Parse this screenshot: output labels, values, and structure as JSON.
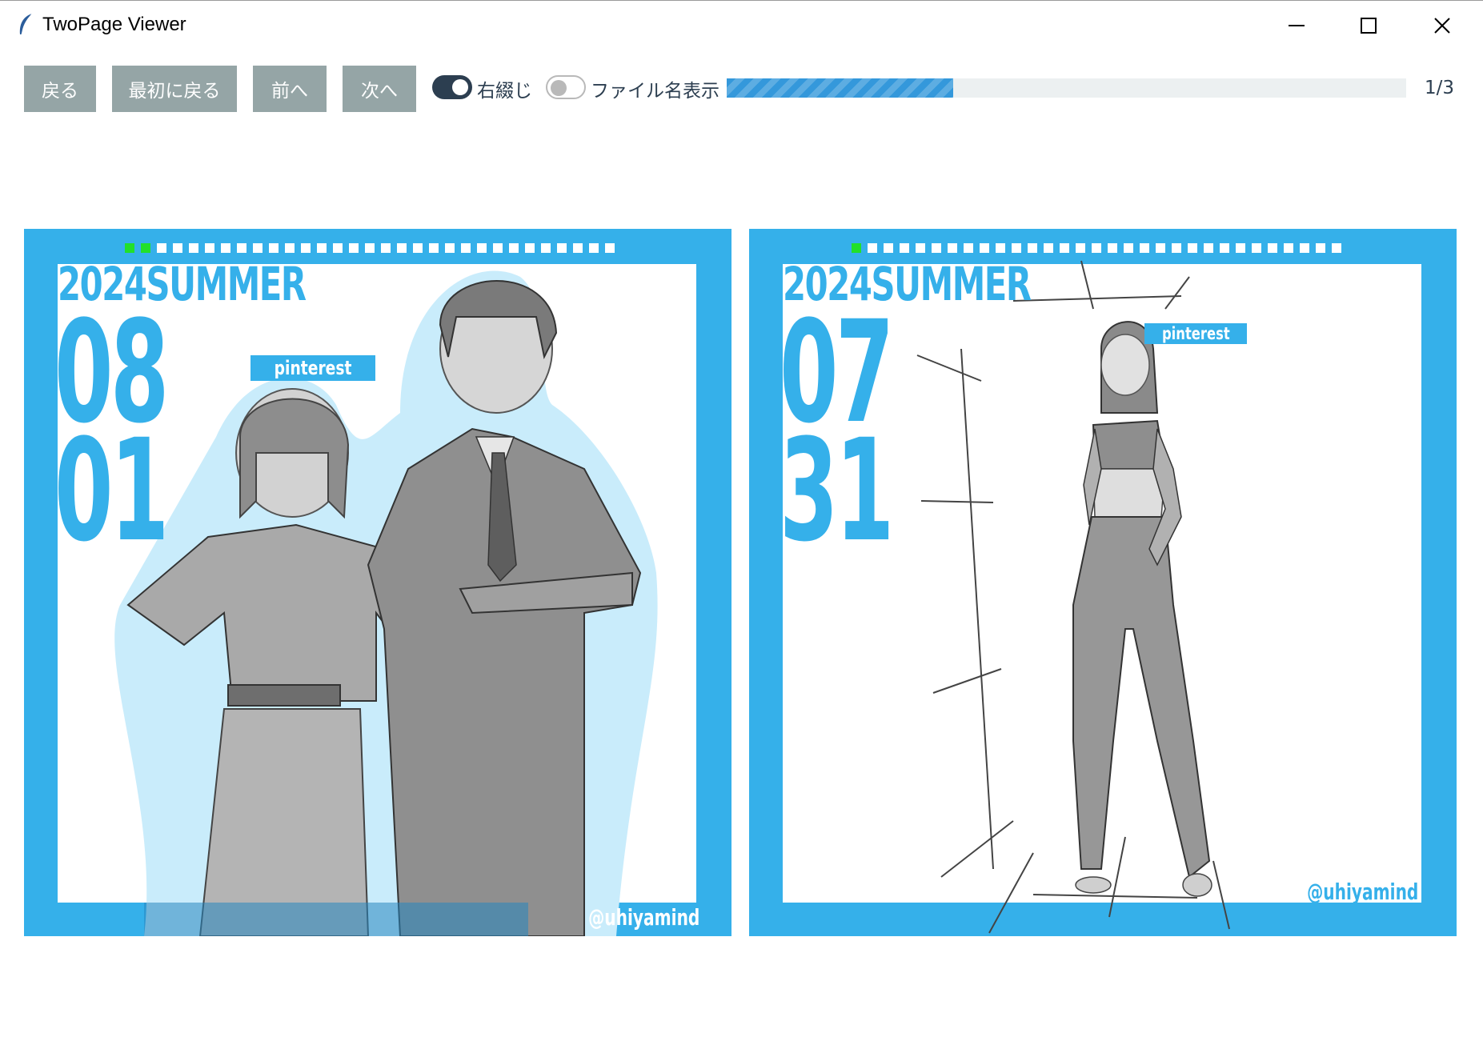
{
  "window": {
    "title": "TwoPage Viewer",
    "app_icon": "feather-icon",
    "controls": [
      "minimize-icon",
      "maximize-icon",
      "close-icon"
    ]
  },
  "toolbar": {
    "back_label": "戻る",
    "first_label": "最初に戻る",
    "prev_label": "前へ",
    "next_label": "次へ",
    "right_binding_label": "右綴じ",
    "right_binding_on": true,
    "filename_label": "ファイル名表示",
    "filename_on": false,
    "progress_fraction": 0.333,
    "page_counter": "1/3"
  },
  "pages": {
    "left": {
      "year_title": "2024SUMMER",
      "month": "08",
      "day": "01",
      "tag": "pinterest",
      "handle": "@uhiyamind"
    },
    "right": {
      "year_title": "2024SUMMER",
      "month": "07",
      "day": "31",
      "tag": "pinterest",
      "handle": "@uhiyamind"
    }
  },
  "colors": {
    "accent": "#35b0ea",
    "button": "#95a5a6",
    "toggle_on": "#2c3e50",
    "progress": "#3498db",
    "dot_active": "#22e02a"
  }
}
